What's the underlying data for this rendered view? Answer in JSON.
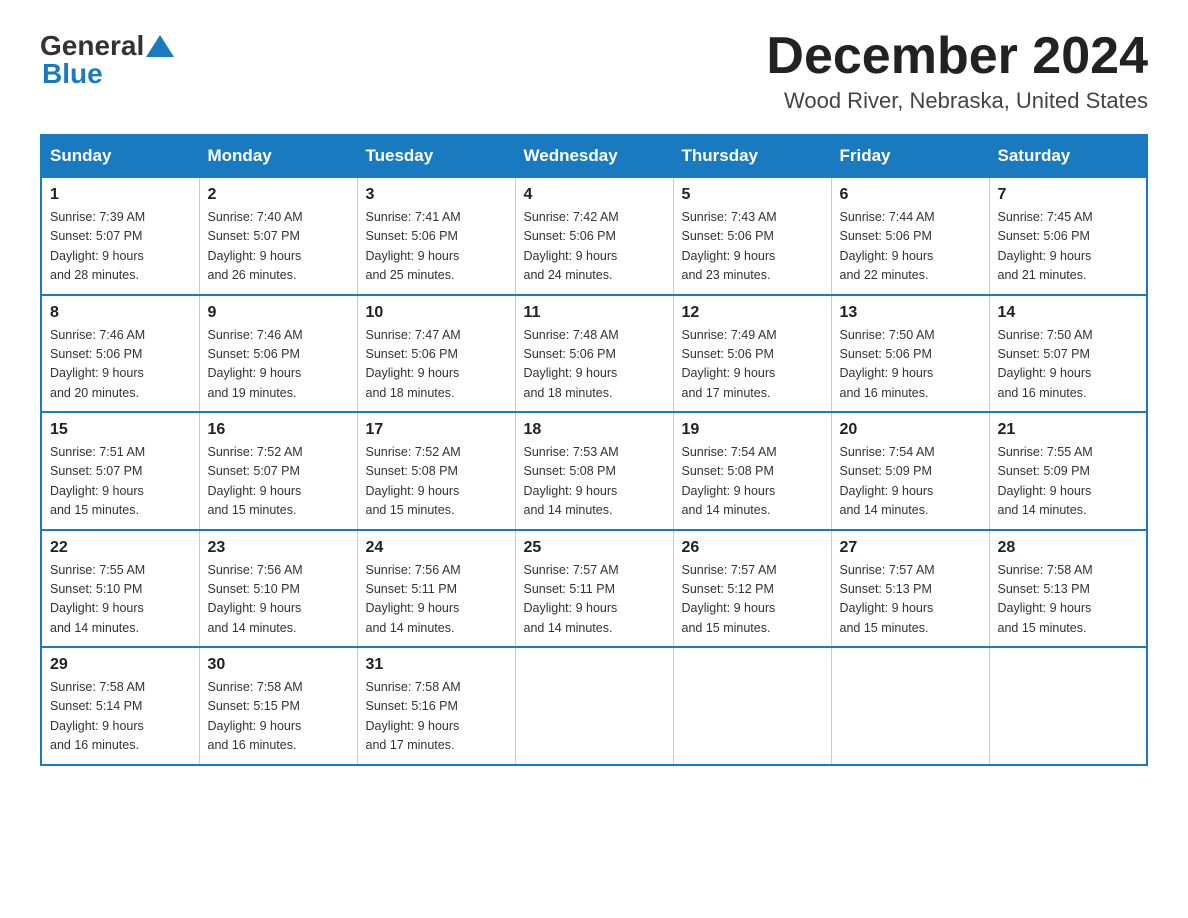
{
  "header": {
    "logo_general": "General",
    "logo_blue": "Blue",
    "month_title": "December 2024",
    "location": "Wood River, Nebraska, United States"
  },
  "days_of_week": [
    "Sunday",
    "Monday",
    "Tuesday",
    "Wednesday",
    "Thursday",
    "Friday",
    "Saturday"
  ],
  "weeks": [
    [
      {
        "day": "1",
        "sunrise": "7:39 AM",
        "sunset": "5:07 PM",
        "daylight": "9 hours and 28 minutes."
      },
      {
        "day": "2",
        "sunrise": "7:40 AM",
        "sunset": "5:07 PM",
        "daylight": "9 hours and 26 minutes."
      },
      {
        "day": "3",
        "sunrise": "7:41 AM",
        "sunset": "5:06 PM",
        "daylight": "9 hours and 25 minutes."
      },
      {
        "day": "4",
        "sunrise": "7:42 AM",
        "sunset": "5:06 PM",
        "daylight": "9 hours and 24 minutes."
      },
      {
        "day": "5",
        "sunrise": "7:43 AM",
        "sunset": "5:06 PM",
        "daylight": "9 hours and 23 minutes."
      },
      {
        "day": "6",
        "sunrise": "7:44 AM",
        "sunset": "5:06 PM",
        "daylight": "9 hours and 22 minutes."
      },
      {
        "day": "7",
        "sunrise": "7:45 AM",
        "sunset": "5:06 PM",
        "daylight": "9 hours and 21 minutes."
      }
    ],
    [
      {
        "day": "8",
        "sunrise": "7:46 AM",
        "sunset": "5:06 PM",
        "daylight": "9 hours and 20 minutes."
      },
      {
        "day": "9",
        "sunrise": "7:46 AM",
        "sunset": "5:06 PM",
        "daylight": "9 hours and 19 minutes."
      },
      {
        "day": "10",
        "sunrise": "7:47 AM",
        "sunset": "5:06 PM",
        "daylight": "9 hours and 18 minutes."
      },
      {
        "day": "11",
        "sunrise": "7:48 AM",
        "sunset": "5:06 PM",
        "daylight": "9 hours and 18 minutes."
      },
      {
        "day": "12",
        "sunrise": "7:49 AM",
        "sunset": "5:06 PM",
        "daylight": "9 hours and 17 minutes."
      },
      {
        "day": "13",
        "sunrise": "7:50 AM",
        "sunset": "5:06 PM",
        "daylight": "9 hours and 16 minutes."
      },
      {
        "day": "14",
        "sunrise": "7:50 AM",
        "sunset": "5:07 PM",
        "daylight": "9 hours and 16 minutes."
      }
    ],
    [
      {
        "day": "15",
        "sunrise": "7:51 AM",
        "sunset": "5:07 PM",
        "daylight": "9 hours and 15 minutes."
      },
      {
        "day": "16",
        "sunrise": "7:52 AM",
        "sunset": "5:07 PM",
        "daylight": "9 hours and 15 minutes."
      },
      {
        "day": "17",
        "sunrise": "7:52 AM",
        "sunset": "5:08 PM",
        "daylight": "9 hours and 15 minutes."
      },
      {
        "day": "18",
        "sunrise": "7:53 AM",
        "sunset": "5:08 PM",
        "daylight": "9 hours and 14 minutes."
      },
      {
        "day": "19",
        "sunrise": "7:54 AM",
        "sunset": "5:08 PM",
        "daylight": "9 hours and 14 minutes."
      },
      {
        "day": "20",
        "sunrise": "7:54 AM",
        "sunset": "5:09 PM",
        "daylight": "9 hours and 14 minutes."
      },
      {
        "day": "21",
        "sunrise": "7:55 AM",
        "sunset": "5:09 PM",
        "daylight": "9 hours and 14 minutes."
      }
    ],
    [
      {
        "day": "22",
        "sunrise": "7:55 AM",
        "sunset": "5:10 PM",
        "daylight": "9 hours and 14 minutes."
      },
      {
        "day": "23",
        "sunrise": "7:56 AM",
        "sunset": "5:10 PM",
        "daylight": "9 hours and 14 minutes."
      },
      {
        "day": "24",
        "sunrise": "7:56 AM",
        "sunset": "5:11 PM",
        "daylight": "9 hours and 14 minutes."
      },
      {
        "day": "25",
        "sunrise": "7:57 AM",
        "sunset": "5:11 PM",
        "daylight": "9 hours and 14 minutes."
      },
      {
        "day": "26",
        "sunrise": "7:57 AM",
        "sunset": "5:12 PM",
        "daylight": "9 hours and 15 minutes."
      },
      {
        "day": "27",
        "sunrise": "7:57 AM",
        "sunset": "5:13 PM",
        "daylight": "9 hours and 15 minutes."
      },
      {
        "day": "28",
        "sunrise": "7:58 AM",
        "sunset": "5:13 PM",
        "daylight": "9 hours and 15 minutes."
      }
    ],
    [
      {
        "day": "29",
        "sunrise": "7:58 AM",
        "sunset": "5:14 PM",
        "daylight": "9 hours and 16 minutes."
      },
      {
        "day": "30",
        "sunrise": "7:58 AM",
        "sunset": "5:15 PM",
        "daylight": "9 hours and 16 minutes."
      },
      {
        "day": "31",
        "sunrise": "7:58 AM",
        "sunset": "5:16 PM",
        "daylight": "9 hours and 17 minutes."
      },
      null,
      null,
      null,
      null
    ]
  ],
  "labels": {
    "sunrise": "Sunrise:",
    "sunset": "Sunset:",
    "daylight": "Daylight:"
  }
}
